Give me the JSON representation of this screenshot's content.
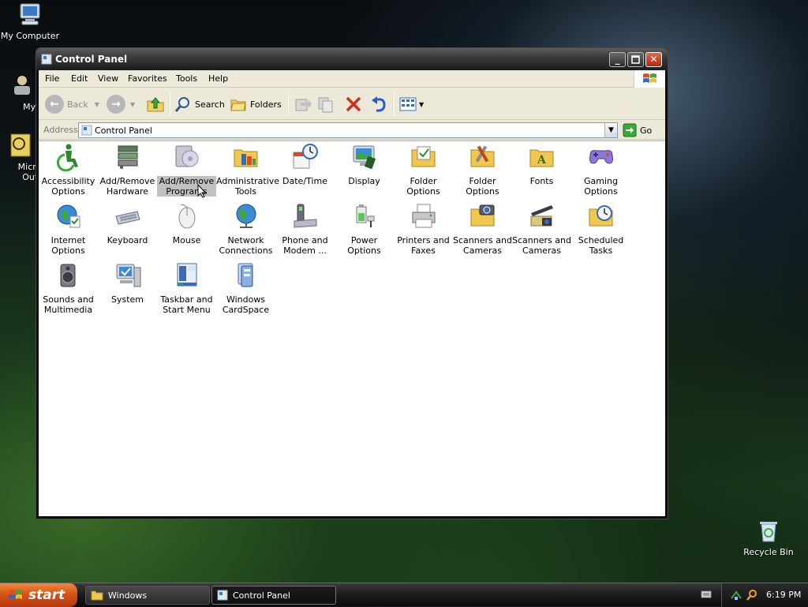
{
  "desktop": {
    "icons": [
      {
        "label": "My Computer"
      },
      {
        "label": "MyPa"
      },
      {
        "label": "Micros"
      },
      {
        "label": "Outlo"
      },
      {
        "label": "Recycle Bin"
      }
    ]
  },
  "window": {
    "title": "Control Panel",
    "menu": [
      "File",
      "Edit",
      "View",
      "Favorites",
      "Tools",
      "Help"
    ],
    "toolbar": {
      "back": "Back",
      "search": "Search",
      "folders": "Folders"
    },
    "address": {
      "label": "Address",
      "value": "Control Panel",
      "go": "Go"
    }
  },
  "items": [
    {
      "label": "Accessibility Options",
      "icon": "accessibility-icon"
    },
    {
      "label": "Add/Remove Hardware",
      "icon": "hardware-icon"
    },
    {
      "label": "Add/Remove Programs",
      "icon": "programs-icon"
    },
    {
      "label": "Administrative Tools",
      "icon": "admin-tools-icon"
    },
    {
      "label": "Date/Time",
      "icon": "clock-icon"
    },
    {
      "label": "Display",
      "icon": "display-icon"
    },
    {
      "label": "Folder Options",
      "icon": "folder-options-icon"
    },
    {
      "label": "Folder Options",
      "icon": "folder-tools-icon"
    },
    {
      "label": "Fonts",
      "icon": "fonts-icon"
    },
    {
      "label": "Gaming Options",
      "icon": "gamepad-icon"
    },
    {
      "label": "Internet Options",
      "icon": "internet-icon"
    },
    {
      "label": "Keyboard",
      "icon": "keyboard-icon"
    },
    {
      "label": "Mouse",
      "icon": "mouse-icon"
    },
    {
      "label": "Network Connections",
      "icon": "network-icon"
    },
    {
      "label": "Phone and Modem ...",
      "icon": "phone-icon"
    },
    {
      "label": "Power Options",
      "icon": "power-icon"
    },
    {
      "label": "Printers and Faxes",
      "icon": "printer-icon"
    },
    {
      "label": "Scanners and Cameras",
      "icon": "scanner-icon"
    },
    {
      "label": "Scanners and Cameras",
      "icon": "scanner-icon"
    },
    {
      "label": "Scheduled Tasks",
      "icon": "scheduled-tasks-icon"
    },
    {
      "label": "Sounds and Multimedia",
      "icon": "speaker-icon"
    },
    {
      "label": "System",
      "icon": "system-icon"
    },
    {
      "label": "Taskbar and Start Menu",
      "icon": "taskbar-icon"
    },
    {
      "label": "Windows CardSpace",
      "icon": "cardspace-icon"
    }
  ],
  "taskbar": {
    "start": "start",
    "tasks": [
      {
        "label": "Windows"
      },
      {
        "label": "Control Panel"
      }
    ],
    "clock": "6:19 PM"
  },
  "colors": {
    "start": "#d5541a",
    "titlebar": "#3b3b3b",
    "selection": "#c0c0c0"
  }
}
